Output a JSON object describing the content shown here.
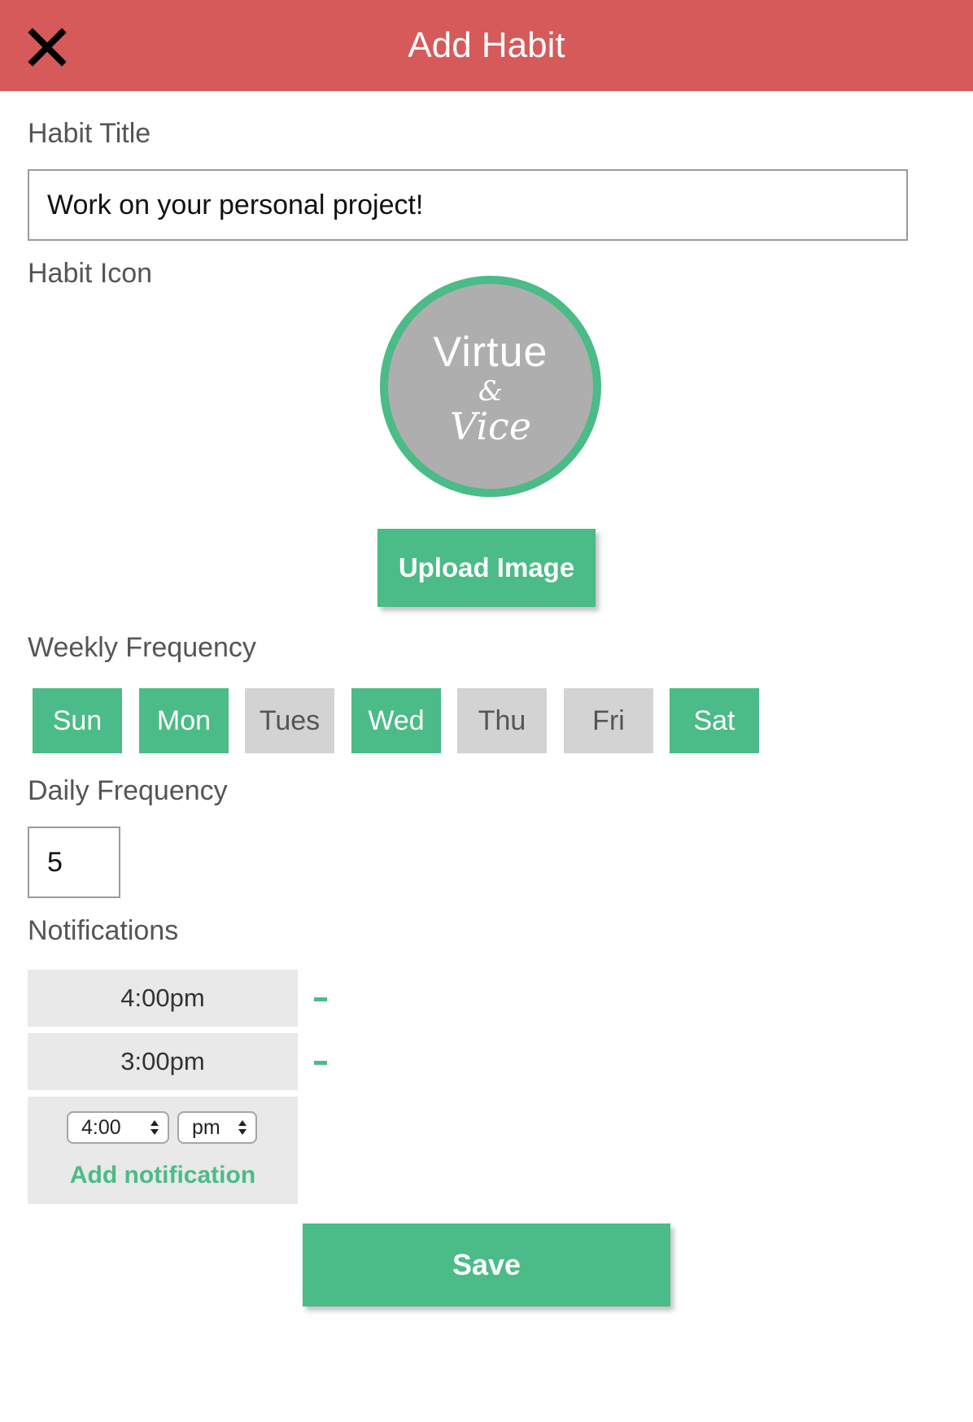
{
  "header": {
    "title": "Add Habit",
    "close_icon": "close-icon"
  },
  "form": {
    "habit_title_label": "Habit Title",
    "habit_title_value": "Work on your personal project!",
    "habit_icon_label": "Habit Icon",
    "icon_logo": {
      "line1": "Virtue",
      "line2": "&",
      "line3": "Vice"
    },
    "upload_button": "Upload Image",
    "weekly_frequency_label": "Weekly Frequency",
    "days": [
      {
        "label": "Sun",
        "selected": true
      },
      {
        "label": "Mon",
        "selected": true
      },
      {
        "label": "Tues",
        "selected": false
      },
      {
        "label": "Wed",
        "selected": true
      },
      {
        "label": "Thu",
        "selected": false
      },
      {
        "label": "Fri",
        "selected": false
      },
      {
        "label": "Sat",
        "selected": true
      }
    ],
    "daily_frequency_label": "Daily Frequency",
    "daily_frequency_value": "5",
    "notifications_label": "Notifications",
    "notifications": [
      {
        "time": "4:00pm"
      },
      {
        "time": "3:00pm"
      }
    ],
    "new_notification": {
      "time_value": "4:00",
      "ampm_value": "pm"
    },
    "add_notification_link": "Add notification",
    "save_button": "Save"
  },
  "colors": {
    "header_bg": "#d65a5a",
    "accent_green": "#4bbb87",
    "day_off_bg": "#d3d3d3",
    "notification_bg": "#e9e9e9"
  }
}
